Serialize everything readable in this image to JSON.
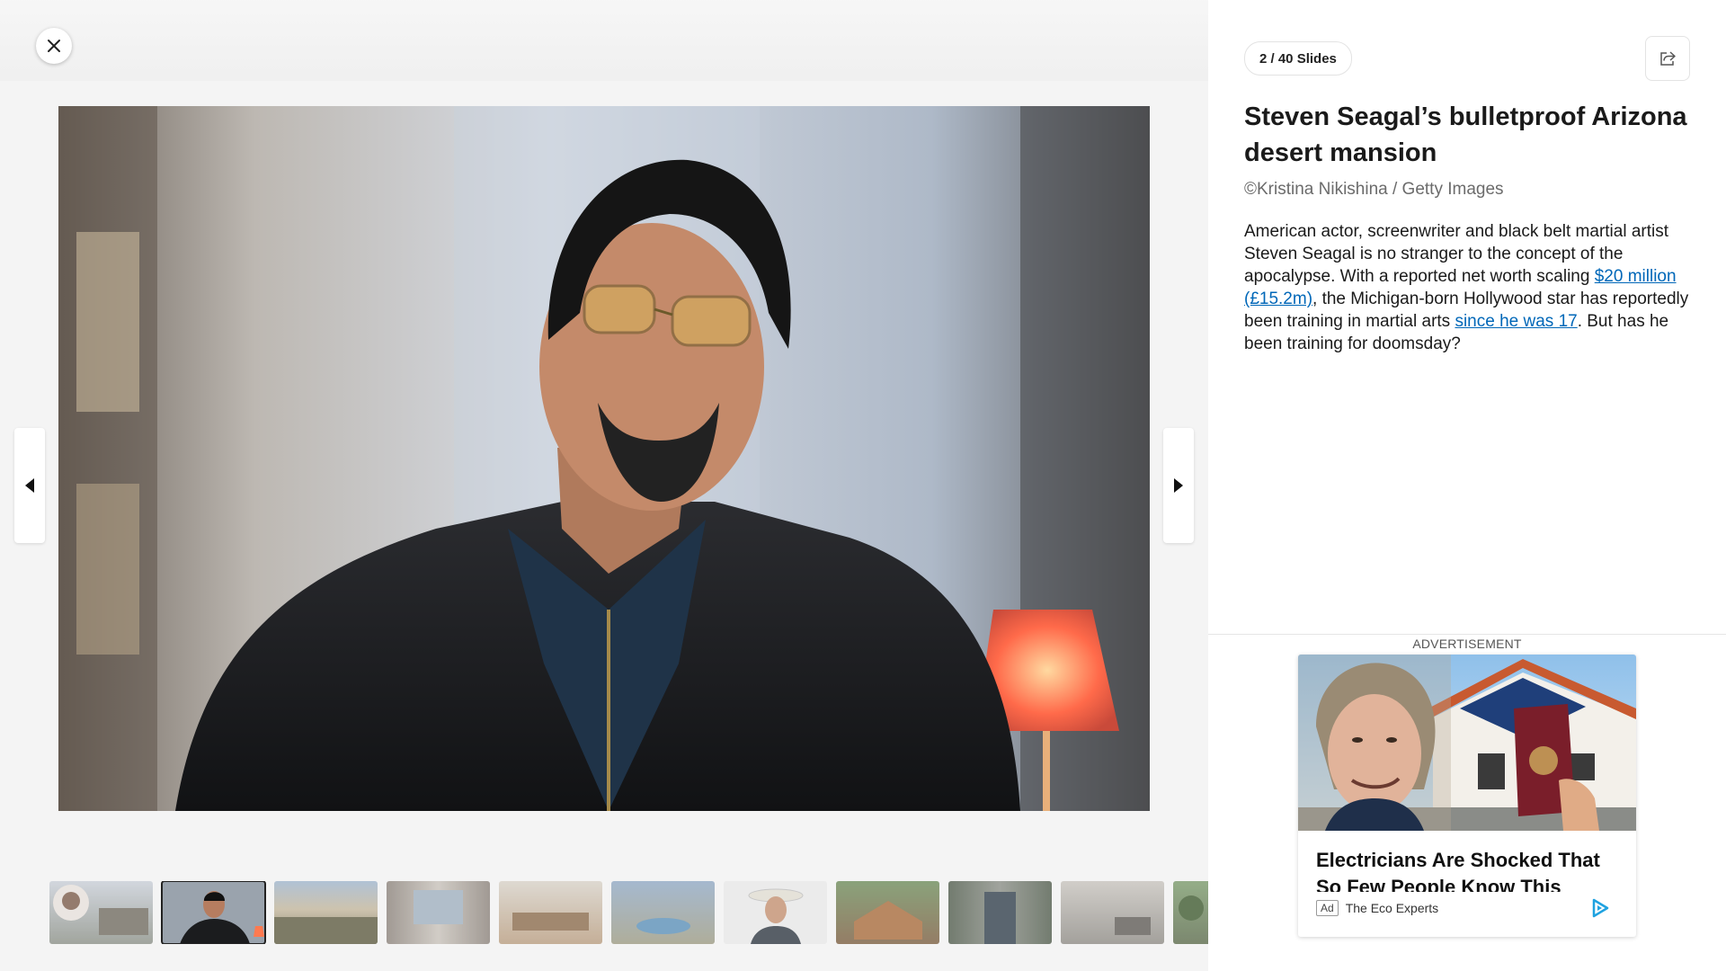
{
  "slide_counter": "2 / 40 Slides",
  "article": {
    "title": "Steven Seagal’s bulletproof Arizona desert mansion",
    "credit": "©Kristina Nikishina / Getty Images",
    "description": {
      "part1": "American actor, screenwriter and black belt martial artist Steven Seagal is no stranger to the concept of the apocalypse. With a reported net worth scaling ",
      "link1": "$20 million (£15.2m)",
      "part2": ", the Michigan-born Hollywood star has reportedly been training in martial arts ",
      "link2": "since he was 17",
      "part3": ". But has he been training for doomsday?"
    }
  },
  "thumbnails": [
    {
      "icon": "portrait-house-thumb",
      "active": false
    },
    {
      "icon": "portrait-thumb",
      "active": true
    },
    {
      "icon": "desert-landscape-thumb",
      "active": false
    },
    {
      "icon": "interior-window-thumb",
      "active": false
    },
    {
      "icon": "kitchen-thumb",
      "active": false
    },
    {
      "icon": "pool-thumb",
      "active": false
    },
    {
      "icon": "cowboy-hat-thumb",
      "active": false
    },
    {
      "icon": "house-exterior-thumb",
      "active": false
    },
    {
      "icon": "doorway-thumb",
      "active": false
    },
    {
      "icon": "room-interior-thumb",
      "active": false
    },
    {
      "icon": "garden-thumb",
      "active": false
    }
  ],
  "advertisement": {
    "label": "ADVERTISEMENT",
    "headline": "Electricians Are Shocked That So Few People Know This About",
    "ad_tag": "Ad",
    "source": "The Eco Experts"
  },
  "colors": {
    "link": "#0067b8",
    "panel_bg": "#ffffff",
    "stage_bg": "#f4f4f4",
    "ad_choices": "#1fa2e0"
  }
}
